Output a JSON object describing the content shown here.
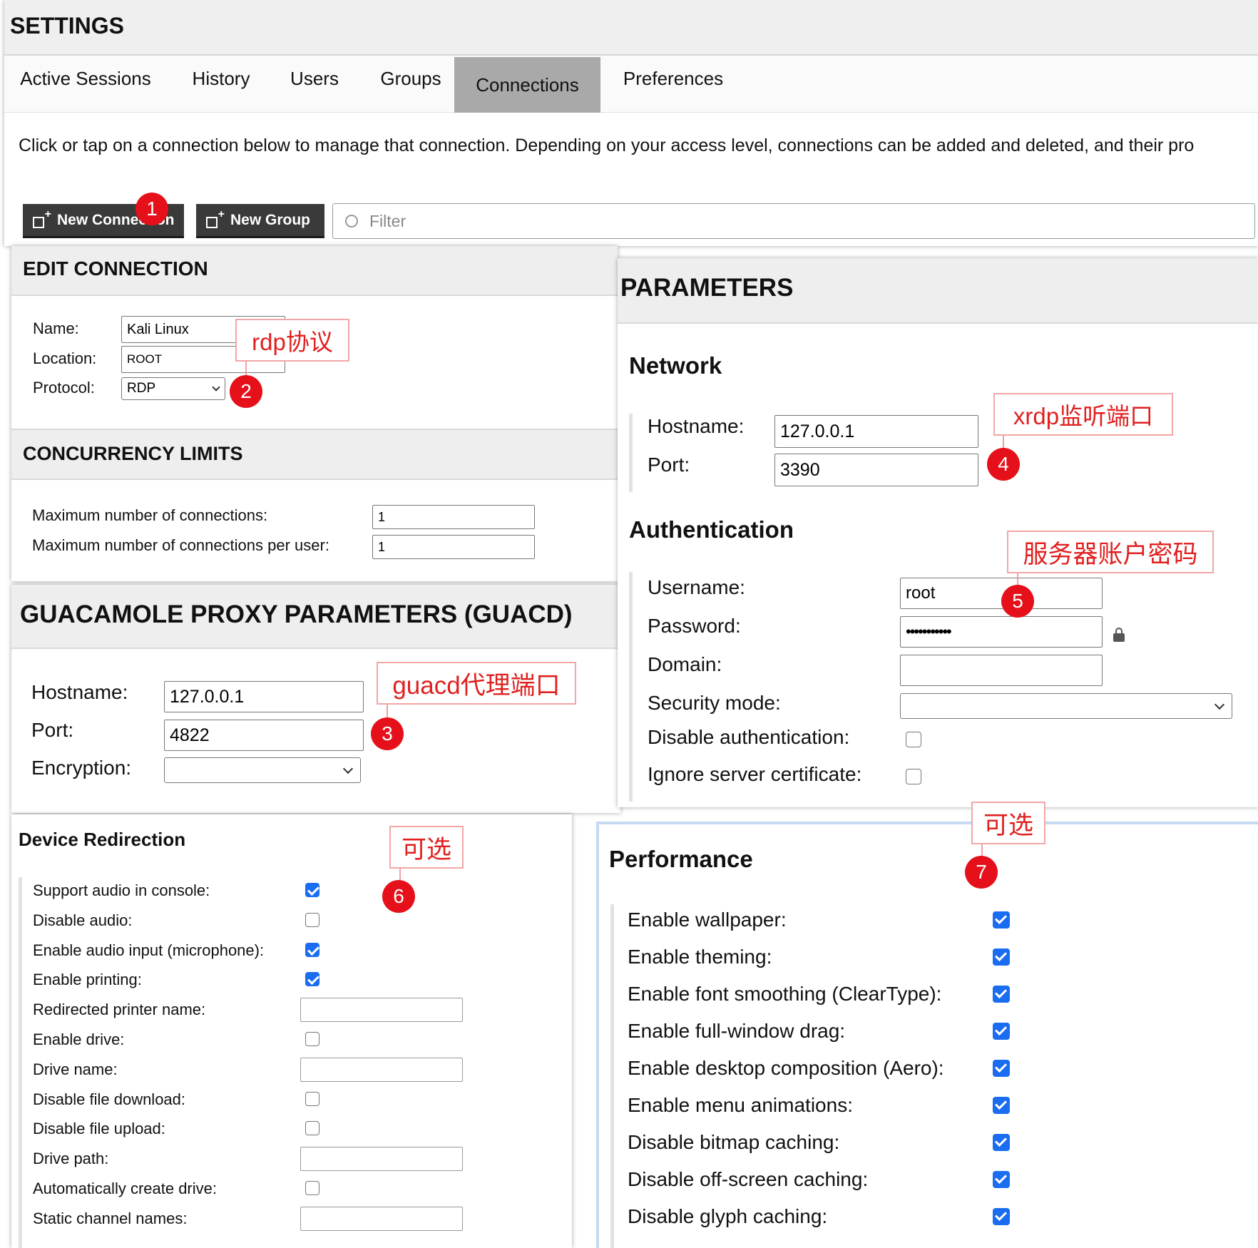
{
  "settings": {
    "title": "SETTINGS",
    "tabs": [
      "Active Sessions",
      "History",
      "Users",
      "Groups",
      "Connections",
      "Preferences"
    ],
    "active_tab": "Connections",
    "description": "Click or tap on a connection below to manage that connection. Depending on your access level, connections can be added and deleted, and their pro",
    "new_connection_label": "New Connection",
    "new_group_label": "New Group",
    "filter_placeholder": "Filter"
  },
  "edit_connection": {
    "title": "EDIT CONNECTION",
    "name_label": "Name:",
    "name_value": "Kali Linux",
    "location_label": "Location:",
    "location_value": "ROOT",
    "protocol_label": "Protocol:",
    "protocol_value": "RDP"
  },
  "concurrency": {
    "title": "CONCURRENCY LIMITS",
    "max_label": "Maximum number of connections:",
    "max_value": "1",
    "max_user_label": "Maximum number of connections per user:",
    "max_user_value": "1"
  },
  "guacd": {
    "title": "GUACAMOLE PROXY PARAMETERS (GUACD)",
    "hostname_label": "Hostname:",
    "hostname_value": "127.0.0.1",
    "port_label": "Port:",
    "port_value": "4822",
    "encryption_label": "Encryption:",
    "encryption_value": ""
  },
  "parameters": {
    "title": "PARAMETERS",
    "network_title": "Network",
    "hostname_label": "Hostname:",
    "hostname_value": "127.0.0.1",
    "port_label": "Port:",
    "port_value": "3390",
    "auth_title": "Authentication",
    "username_label": "Username:",
    "username_value": "root",
    "password_label": "Password:",
    "password_value": "•••••••••••",
    "domain_label": "Domain:",
    "domain_value": "",
    "security_label": "Security mode:",
    "security_value": "",
    "disable_auth_label": "Disable authentication:",
    "ignore_cert_label": "Ignore server certificate:"
  },
  "device_redirection": {
    "title": "Device Redirection",
    "items": [
      {
        "label": "Support audio in console:",
        "type": "checkbox",
        "checked": true
      },
      {
        "label": "Disable audio:",
        "type": "checkbox",
        "checked": false
      },
      {
        "label": "Enable audio input (microphone):",
        "type": "checkbox",
        "checked": true
      },
      {
        "label": "Enable printing:",
        "type": "checkbox",
        "checked": true
      },
      {
        "label": "Redirected printer name:",
        "type": "text",
        "value": ""
      },
      {
        "label": "Enable drive:",
        "type": "checkbox",
        "checked": false
      },
      {
        "label": "Drive name:",
        "type": "text",
        "value": ""
      },
      {
        "label": "Disable file download:",
        "type": "checkbox",
        "checked": false
      },
      {
        "label": "Disable file upload:",
        "type": "checkbox",
        "checked": false
      },
      {
        "label": "Drive path:",
        "type": "text",
        "value": ""
      },
      {
        "label": "Automatically create drive:",
        "type": "checkbox",
        "checked": false
      },
      {
        "label": "Static channel names:",
        "type": "text",
        "value": ""
      }
    ]
  },
  "performance": {
    "title": "Performance",
    "items": [
      {
        "label": "Enable wallpaper:",
        "checked": true
      },
      {
        "label": "Enable theming:",
        "checked": true
      },
      {
        "label": "Enable font smoothing (ClearType):",
        "checked": true
      },
      {
        "label": "Enable full-window drag:",
        "checked": true
      },
      {
        "label": "Enable desktop composition (Aero):",
        "checked": true
      },
      {
        "label": "Enable menu animations:",
        "checked": true
      },
      {
        "label": "Disable bitmap caching:",
        "checked": true
      },
      {
        "label": "Disable off-screen caching:",
        "checked": true
      },
      {
        "label": "Disable glyph caching:",
        "checked": true
      }
    ]
  },
  "annotations": {
    "badges": [
      "1",
      "2",
      "3",
      "4",
      "5",
      "6",
      "7"
    ],
    "rdp_protocol": "rdp协议",
    "guacd_port": "guacd代理端口",
    "xrdp_port": "xrdp监听端口",
    "server_account": "服务器账户密码",
    "optional_6": "可选",
    "optional_7": "可选"
  },
  "colors": {
    "annotation_red": "#e5101a",
    "checkbox_blue": "#1a6cf0",
    "button_dark": "#3a3a3a",
    "active_tab": "#a9a9a9"
  }
}
